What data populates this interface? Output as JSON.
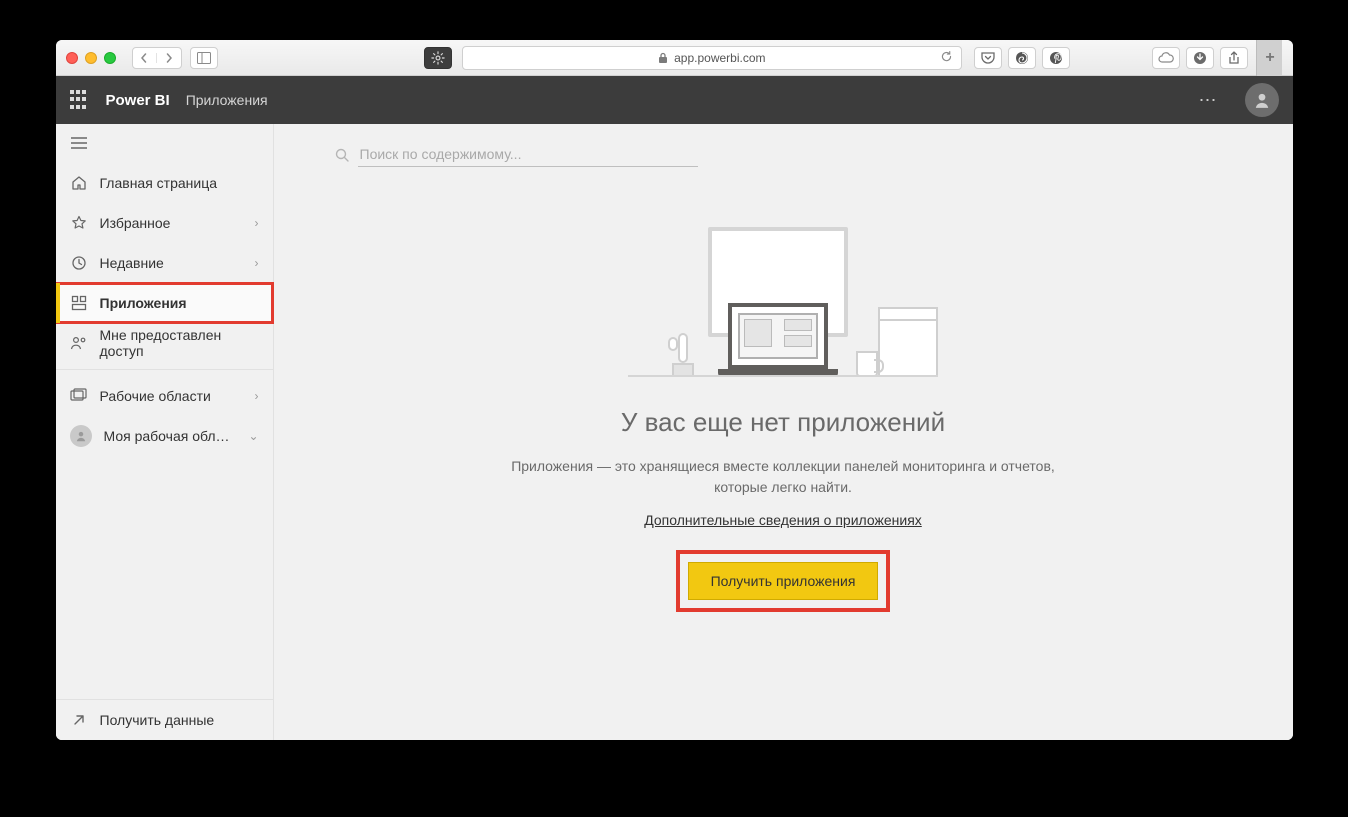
{
  "browser": {
    "url_host": "app.powerbi.com"
  },
  "header": {
    "brand": "Power BI",
    "breadcrumb": "Приложения"
  },
  "sidebar": {
    "home": "Главная страница",
    "favorites": "Избранное",
    "recent": "Недавние",
    "apps": "Приложения",
    "shared": "Мне предоставлен доступ",
    "workspaces": "Рабочие области",
    "my_workspace": "Моя рабочая обла...",
    "get_data": "Получить данные"
  },
  "search": {
    "placeholder": "Поиск по содержимому..."
  },
  "empty": {
    "title": "У вас еще нет приложений",
    "desc": "Приложения — это хранящиеся вместе коллекции панелей мониторинга и отчетов, которые легко найти.",
    "link": "Дополнительные сведения о приложениях",
    "button": "Получить приложения"
  }
}
